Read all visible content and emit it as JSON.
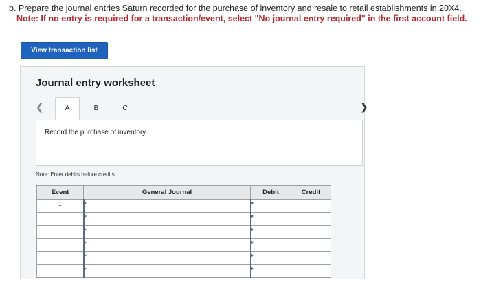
{
  "question": {
    "line1": "b. Prepare the journal entries Saturn recorded for the purchase of inventory and resale to retail establishments in 20X4.",
    "line2": "Note: If no entry is required for a transaction/event, select \"No journal entry required\" in the first account field."
  },
  "view_button": {
    "label": "View transaction list"
  },
  "worksheet": {
    "title": "Journal entry worksheet",
    "prev_icon": "chevron-left-icon",
    "next_icon": "chevron-right-icon",
    "tabs": [
      {
        "label": "A",
        "active": true
      },
      {
        "label": "B",
        "active": false
      },
      {
        "label": "C",
        "active": false
      }
    ],
    "instruction": "Record the purchase of inventory.",
    "note": "Note: Enter debits before credits.",
    "table": {
      "headers": [
        "Event",
        "General Journal",
        "Debit",
        "Credit"
      ],
      "rows": [
        {
          "event": "1"
        },
        {
          "event": ""
        },
        {
          "event": ""
        },
        {
          "event": ""
        },
        {
          "event": ""
        },
        {
          "event": ""
        }
      ]
    }
  },
  "colors": {
    "button_bg": "#1f63bd",
    "note_red": "#b7292d",
    "panel_bg": "#f4f5f6"
  }
}
